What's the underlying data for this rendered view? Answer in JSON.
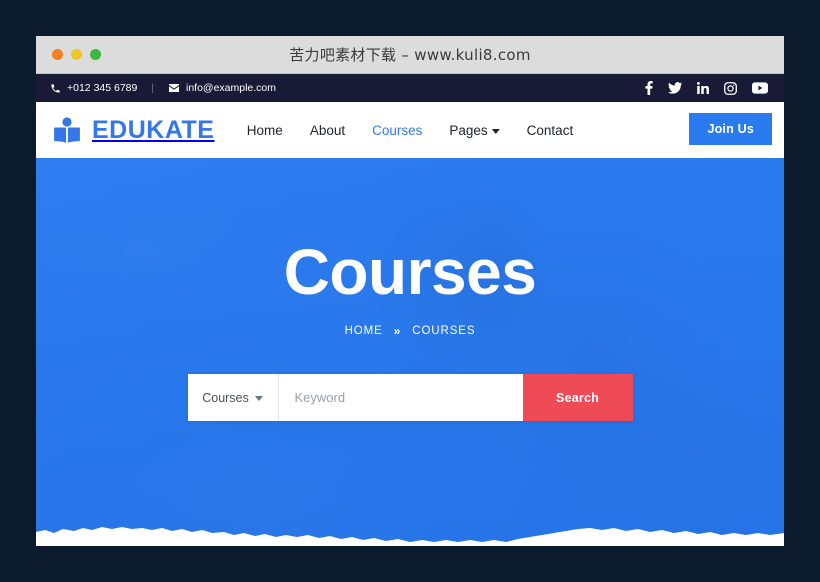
{
  "window": {
    "title": "苦力吧素材下载 – www.kuli8.com",
    "traffic_lights": [
      "close",
      "minimize",
      "maximize"
    ],
    "colors": {
      "desktop_background": "#0c1a2d",
      "titlebar": "#dcdcdc",
      "dot_orange": "#f58020",
      "dot_yellow": "#f1c42b",
      "dot_green": "#3fb63f"
    }
  },
  "topbar": {
    "phone": "+012 345 6789",
    "separator": "|",
    "email": "info@example.com",
    "background": "#191b36",
    "socials": [
      {
        "name": "facebook-icon",
        "label": "f"
      },
      {
        "name": "twitter-icon",
        "label": "t"
      },
      {
        "name": "linkedin-icon",
        "label": "in"
      },
      {
        "name": "instagram-icon",
        "label": "ig"
      },
      {
        "name": "youtube-icon",
        "label": "yt"
      }
    ]
  },
  "navbar": {
    "brand": "EDUKATE",
    "brand_color": "#3577e8",
    "links": [
      {
        "label": "Home",
        "active": false,
        "dropdown": false
      },
      {
        "label": "About",
        "active": false,
        "dropdown": false
      },
      {
        "label": "Courses",
        "active": true,
        "dropdown": false
      },
      {
        "label": "Pages",
        "active": false,
        "dropdown": true
      },
      {
        "label": "Contact",
        "active": false,
        "dropdown": false
      }
    ],
    "cta_label": "Join Us",
    "cta_color": "#2a7bef"
  },
  "hero": {
    "title": "Courses",
    "breadcrumb": {
      "home": "HOME",
      "separator": "»",
      "current": "COURSES"
    },
    "overlay_color": "#2a7bef",
    "search": {
      "category": "Courses",
      "placeholder": "Keyword",
      "value": "",
      "button_label": "Search",
      "button_color": "#ef4b57"
    }
  }
}
